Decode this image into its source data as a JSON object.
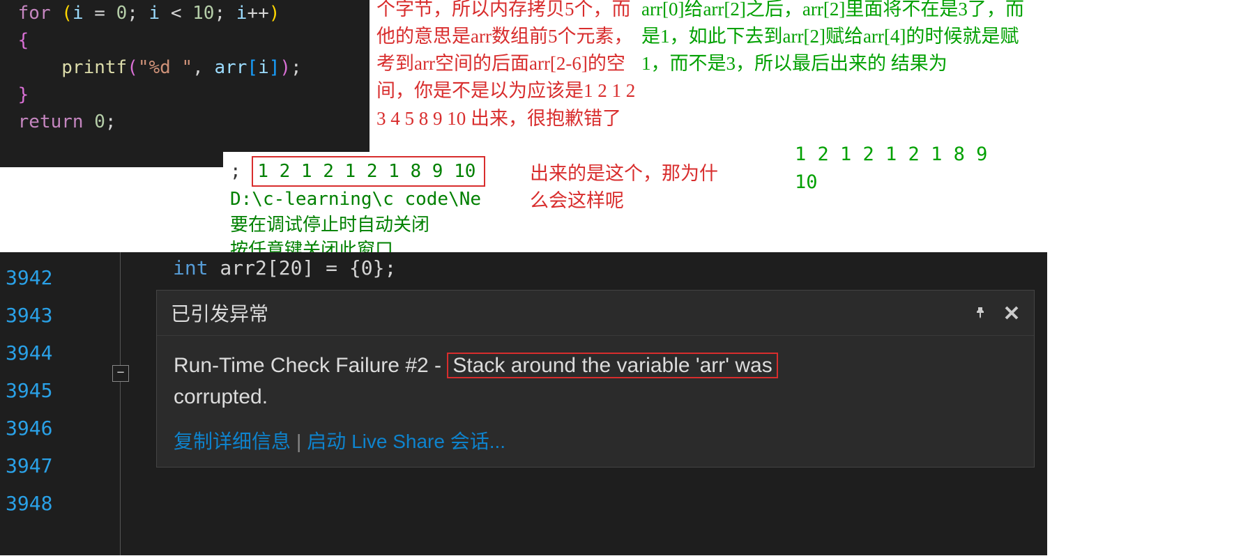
{
  "code_top": {
    "line1": {
      "for": "for",
      "pre": "(",
      "var_i1": "i",
      "eq": " = ",
      "zero": "0",
      "semi1": "; ",
      "var_i2": "i",
      "lt": " < ",
      "ten": "10",
      "semi2": "; ",
      "var_i3": "i",
      "inc": "++",
      "post": ")"
    },
    "line2": "{",
    "line3": {
      "func": "printf",
      "open": "(",
      "str": "\"%d \"",
      "comma": ", ",
      "arr": "arr",
      "lb": "[",
      "idx": "i",
      "rb": "]",
      "close": ")",
      "semi": ";"
    },
    "line4": "}",
    "line5": {
      "ret": "return",
      "sp": " ",
      "zero": "0",
      "semi": ";"
    }
  },
  "red_annotation_1": "个字节，所以内存拷贝5个，而他的意思是arr数组前5个元素，考到arr空间的后面arr[2-6]的空间，你是不是以为应该是1 2 1 2 3 4 5 8 9 10 出来，很抱歉错了",
  "red_annotation_2": "出来的是这个，那为什么会这样呢",
  "green_annotation_1": "arr[0]给arr[2]之后，arr[2]里面将不在是3了，而是1，如此下去到arr[2]赋给arr[4]的时候就是赋1，而不是3，所以最后出来的 结果为",
  "green_result_tail": "1 2 1 2 1 2 1 8 9",
  "green_result_tail2": "10",
  "console": {
    "pre": ";",
    "result": "1 2 1 2 1 2 1 8 9 10",
    "path": "D:\\c-learning\\c code\\Ne",
    "msg1": "要在调试停止时自动关闭",
    "msg2": "按任意键关闭此窗口. . ."
  },
  "ide": {
    "gutter": [
      "3942",
      "3943",
      "3944",
      "3945",
      "3946",
      "3947",
      "3948"
    ],
    "fold_icon": "−",
    "int_line": {
      "type": "int",
      "rest": " arr2[20] = {0};"
    }
  },
  "exception": {
    "title": "已引发异常",
    "body_pre": "Run-Time Check Failure #2 - ",
    "body_highlight": "Stack around the variable 'arr' was",
    "body_post": "corrupted.",
    "link1": "复制详细信息",
    "link2": "启动 Live Share 会话..."
  }
}
